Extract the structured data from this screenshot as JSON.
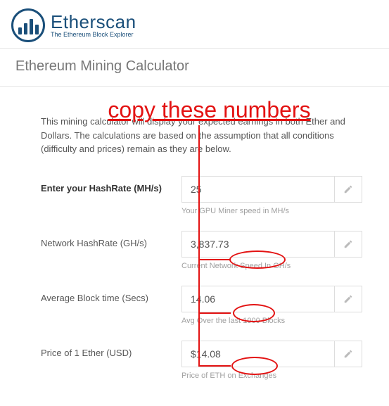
{
  "brand": {
    "name": "Etherscan",
    "tagline": "The Ethereum Block Explorer"
  },
  "page_title": "Ethereum Mining Calculator",
  "annotation_text": "copy these numbers",
  "intro": "This mining calculator will display your expected earnings in both Ether and Dollars. The calculations are based on the assumption that all conditions (difficulty and prices) remain as they are below.",
  "rows": [
    {
      "label": "Enter your HashRate (MH/s)",
      "value": "25",
      "help": "Your GPU Miner speed in MH/s",
      "bold": true
    },
    {
      "label": "Network HashRate (GH/s)",
      "value": "3,837.73",
      "help": "Current Network Speed In GH/s",
      "bold": false
    },
    {
      "label": "Average Block time (Secs)",
      "value": "14.06",
      "help": "Avg Over the last 1000 Blocks",
      "bold": false
    },
    {
      "label": "Price of 1 Ether (USD)",
      "value": "$14.08",
      "help": "Price of ETH on Exchanges",
      "bold": false
    }
  ]
}
